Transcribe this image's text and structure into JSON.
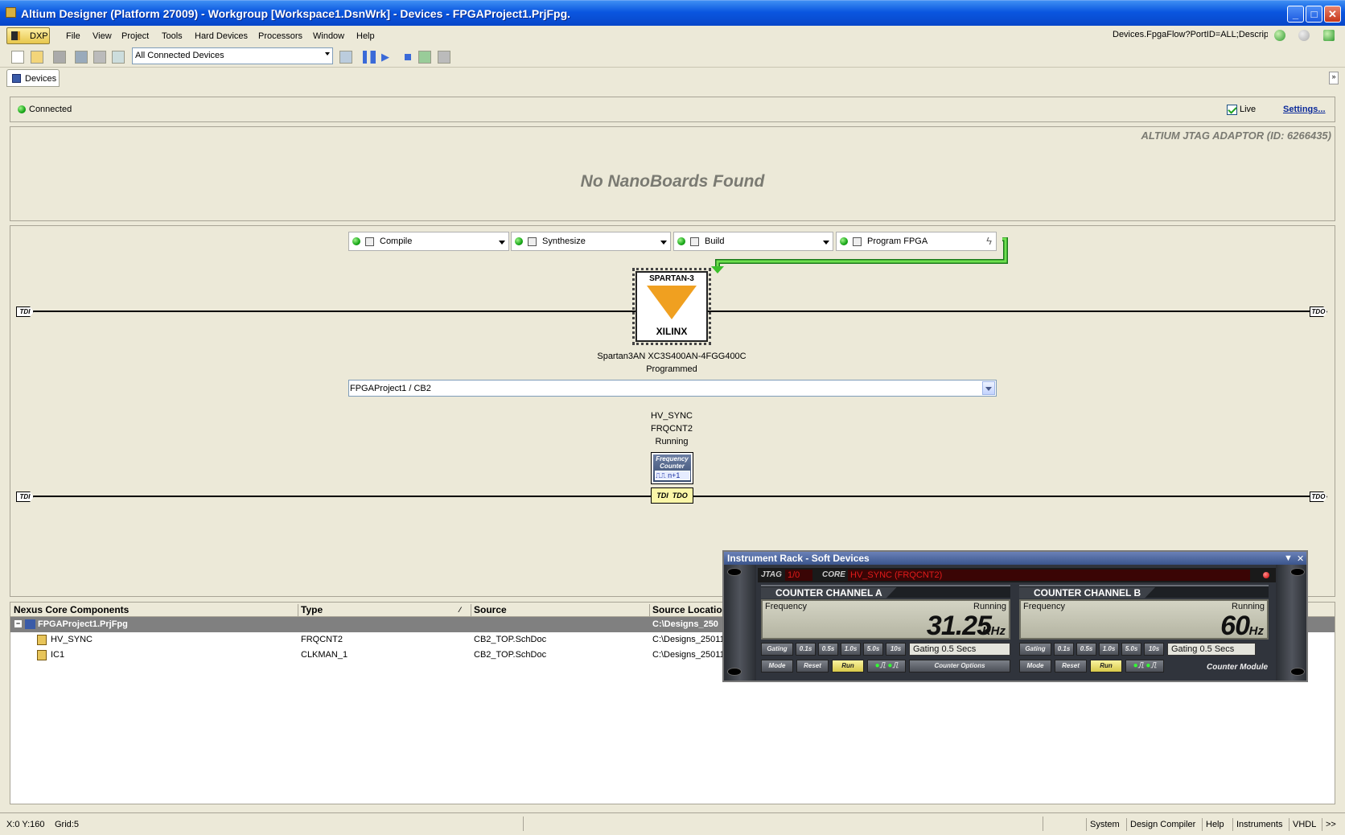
{
  "window": {
    "title": "Altium Designer (Platform 27009) - Workgroup [Workspace1.DsnWrk] - Devices - FPGAProject1.PrjFpg.",
    "min": "_",
    "max": "□",
    "close": "✕"
  },
  "menu": {
    "dxp": "DXP",
    "items": [
      "File",
      "View",
      "Project",
      "Tools",
      "Hard Devices",
      "Processors",
      "Window",
      "Help"
    ]
  },
  "address": "Devices.FpgaFlow?PortID=ALL;Descrip",
  "toolbar": {
    "device_filter": "All Connected Devices"
  },
  "tab": {
    "label": "Devices"
  },
  "connection": {
    "status": "Connected",
    "live_label": "Live",
    "settings_label": "Settings..."
  },
  "nanoboard": {
    "adaptor": "ALTIUM JTAG ADAPTOR (ID: 6266435)",
    "message": "No NanoBoards Found"
  },
  "flow": {
    "steps": [
      "Compile",
      "Synthesize",
      "Build",
      "Program FPGA"
    ]
  },
  "chain": {
    "tdi": "TDI",
    "tdo": "TDO"
  },
  "fpga": {
    "brand_top": "SPARTAN-3",
    "brand_bottom": "XILINX",
    "name": "Spartan3AN XC3S400AN-4FGG400C",
    "status": "Programmed",
    "project": "FPGAProject1 / CB2"
  },
  "soft_device": {
    "name": "HV_SYNC",
    "type": "FRQCNT2",
    "status": "Running",
    "icon_title": "Frequency Counter",
    "icon_wave": "⎍⎍ n+1",
    "tdi": "TDI",
    "tdo": "TDO"
  },
  "grid": {
    "columns": [
      "Nexus Core Components",
      "Type",
      "Source",
      "Source Location"
    ],
    "rows": [
      {
        "name": "FPGAProject1.PrjFpg",
        "type": "",
        "source": "",
        "location": "C:\\Designs_250"
      },
      {
        "name": "HV_SYNC",
        "type": "FRQCNT2",
        "source": "CB2_TOP.SchDoc",
        "location": "C:\\Designs_25011"
      },
      {
        "name": "IC1",
        "type": "CLKMAN_1",
        "source": "CB2_TOP.SchDoc",
        "location": "C:\\Designs_25011"
      }
    ]
  },
  "rack": {
    "title": "Instrument Rack - Soft Devices",
    "jtag_label": "JTAG",
    "jtag_value": "1/0",
    "core_label": "CORE",
    "core_value": "HV_SYNC (FRQCNT2)",
    "channels": [
      {
        "title": "COUNTER CHANNEL A",
        "freq_label": "Frequency",
        "state": "Running",
        "value": "31.25",
        "unit": "KHz",
        "gating_value": "Gating  0.5 Secs"
      },
      {
        "title": "COUNTER CHANNEL B",
        "freq_label": "Frequency",
        "state": "Running",
        "value": "60",
        "unit": "Hz",
        "gating_value": "Gating  0.5 Secs"
      }
    ],
    "gating_buttons": [
      "Gating",
      "0.1s",
      "0.5s",
      "1.0s",
      "5.0s",
      "10s"
    ],
    "mode_label": "Mode",
    "reset_label": "Reset",
    "run_label": "Run",
    "counter_options": "Counter Options",
    "module_label": "Counter Module"
  },
  "status": {
    "coords": "X:0 Y:160",
    "grid": "Grid:5",
    "panels": [
      "System",
      "Design Compiler",
      "Help",
      "Instruments",
      "VHDL",
      ">>"
    ]
  }
}
